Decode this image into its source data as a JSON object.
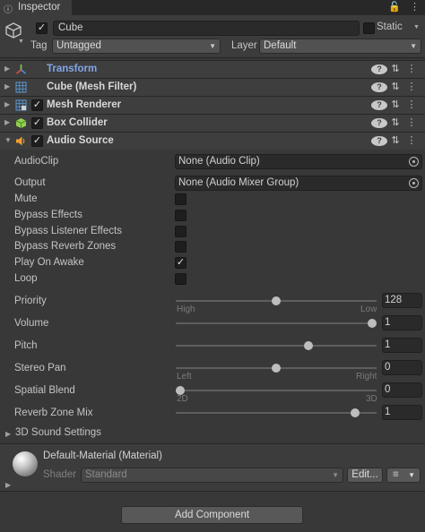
{
  "window": {
    "tab_title": "Inspector",
    "tab_icon": "info-icon",
    "lock_icon": "lock-icon",
    "menu_icon": "kebab-menu-icon"
  },
  "gameobject": {
    "active": true,
    "name": "Cube",
    "static_label": "Static",
    "static_checked": false,
    "tag_label": "Tag",
    "tag_value": "Untagged",
    "layer_label": "Layer",
    "layer_value": "Default"
  },
  "components": [
    {
      "name": "Transform",
      "icon": "transform-icon",
      "has_checkbox": false,
      "expanded": false,
      "highlight": true
    },
    {
      "name": "Cube (Mesh Filter)",
      "icon": "mesh-filter-icon",
      "has_checkbox": false,
      "expanded": false
    },
    {
      "name": "Mesh Renderer",
      "icon": "mesh-renderer-icon",
      "has_checkbox": true,
      "checked": true,
      "expanded": false
    },
    {
      "name": "Box Collider",
      "icon": "box-collider-icon",
      "has_checkbox": true,
      "checked": true,
      "expanded": false
    },
    {
      "name": "Audio Source",
      "icon": "audio-source-icon",
      "has_checkbox": true,
      "checked": true,
      "expanded": true
    }
  ],
  "audio_source": {
    "audioclip": {
      "label": "AudioClip",
      "value": "None (Audio Clip)"
    },
    "output": {
      "label": "Output",
      "value": "None (Audio Mixer Group)"
    },
    "toggles": [
      {
        "label": "Mute",
        "checked": false
      },
      {
        "label": "Bypass Effects",
        "checked": false
      },
      {
        "label": "Bypass Listener Effects",
        "checked": false
      },
      {
        "label": "Bypass Reverb Zones",
        "checked": false
      },
      {
        "label": "Play On Awake",
        "checked": true
      },
      {
        "label": "Loop",
        "checked": false
      }
    ],
    "sliders": [
      {
        "label": "Priority",
        "value": "128",
        "fraction": 0.5,
        "min_label": "High",
        "max_label": "Low"
      },
      {
        "label": "Volume",
        "value": "1",
        "fraction": 1.0
      },
      {
        "label": "Pitch",
        "value": "1",
        "fraction": 0.667
      },
      {
        "label": "Stereo Pan",
        "value": "0",
        "fraction": 0.5,
        "min_label": "Left",
        "max_label": "Right"
      },
      {
        "label": "Spatial Blend",
        "value": "0",
        "fraction": 0.0,
        "min_label": "2D",
        "max_label": "3D"
      },
      {
        "label": "Reverb Zone Mix",
        "value": "1",
        "fraction": 0.909
      }
    ],
    "sound_settings_label": "3D Sound Settings"
  },
  "material": {
    "name": "Default-Material (Material)",
    "shader_label": "Shader",
    "shader_value": "Standard",
    "edit_label": "Edit..."
  },
  "add_component_label": "Add Component"
}
